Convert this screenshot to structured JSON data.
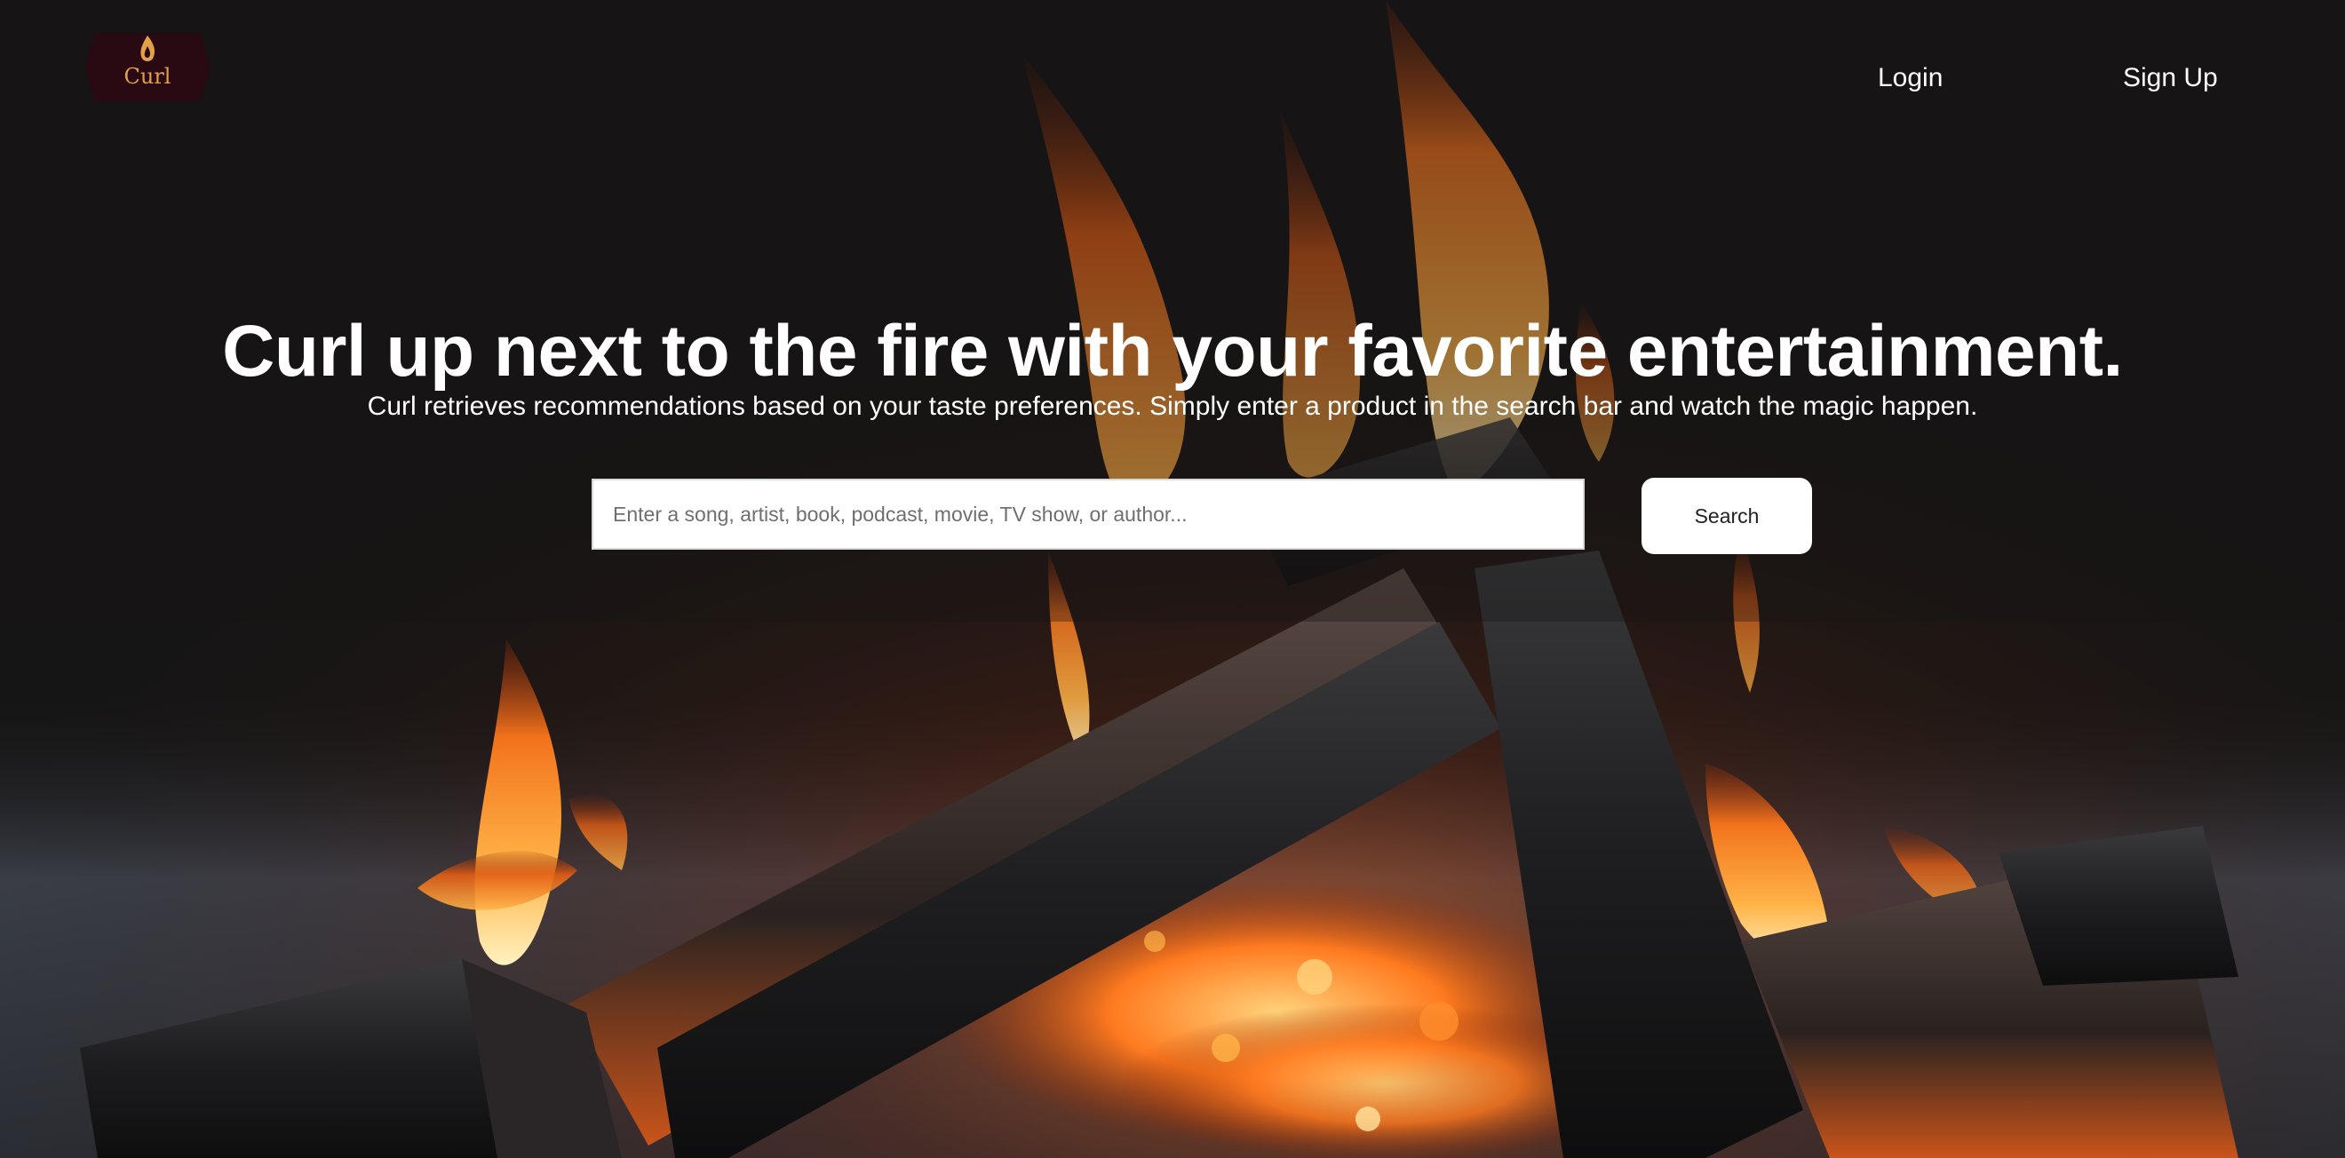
{
  "header": {
    "logo_text": "Curl",
    "nav": {
      "login_label": "Login",
      "signup_label": "Sign Up"
    }
  },
  "hero": {
    "title": "Curl up next to the fire with your favorite entertainment.",
    "subtitle": "Curl retrieves recommendations based on your taste preferences. Simply enter a product in the search bar and watch the magic happen."
  },
  "search": {
    "placeholder": "Enter a song, artist, book, podcast, movie, TV show, or author...",
    "value": "",
    "button_label": "Search"
  },
  "background": {
    "icon": "campfire-image"
  },
  "colors": {
    "logo_badge": "#2a0a12",
    "logo_accent": "#e3a04a",
    "text": "#ffffff",
    "button_bg": "#ffffff"
  }
}
